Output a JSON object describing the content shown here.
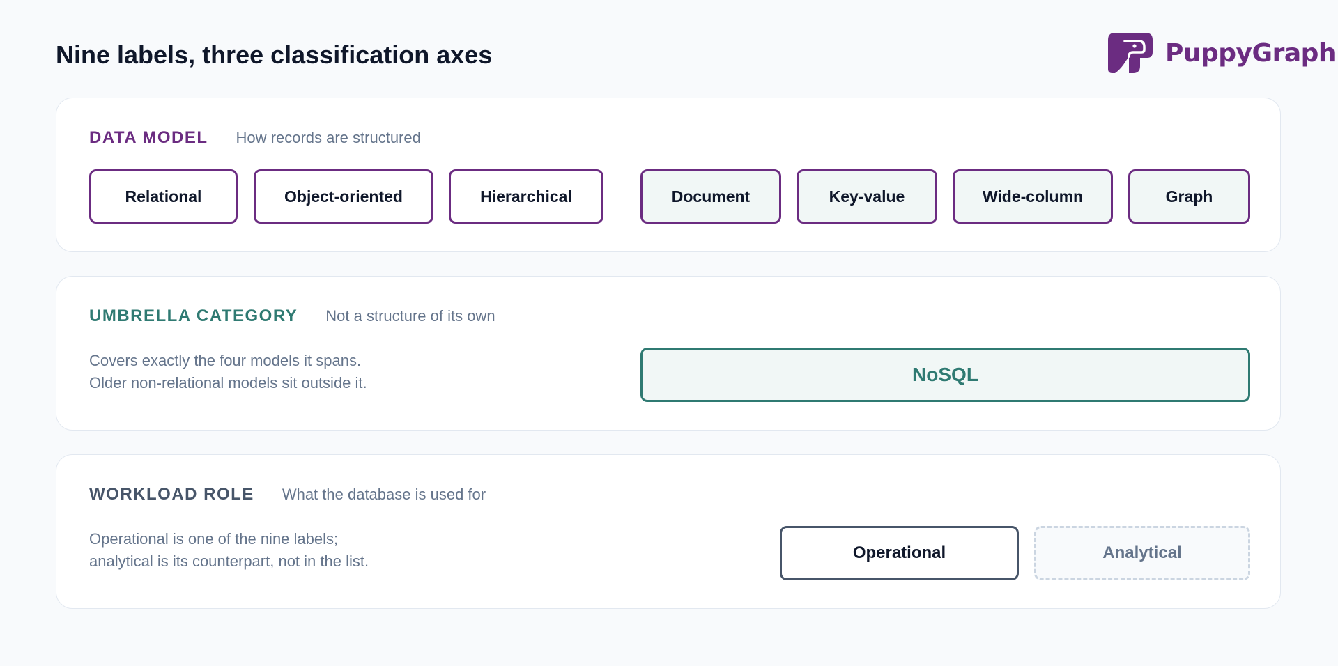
{
  "header": {
    "title": "Nine labels, three classification axes",
    "brand_name": "PuppyGraph"
  },
  "colors": {
    "brand": "#6b2c81",
    "umbrella": "#2f7a72",
    "workload": "#475569",
    "muted": "#64748b"
  },
  "data_model": {
    "axis_name": "DATA MODEL",
    "description": "How records are structured",
    "labels": [
      "Relational",
      "Object-oriented",
      "Hierarchical",
      "Document",
      "Key-value",
      "Wide-column",
      "Graph"
    ]
  },
  "umbrella": {
    "axis_name": "UMBRELLA CATEGORY",
    "description": "Not a structure of its own",
    "note_lines": [
      "Covers exactly the four models it spans.",
      "Older non-relational models sit outside it."
    ],
    "label": "NoSQL"
  },
  "workload": {
    "axis_name": "WORKLOAD ROLE",
    "description": "What the database is used for",
    "note_lines": [
      "Operational is one of the nine labels;",
      "analytical is its counterpart, not in the list."
    ],
    "operational_label": "Operational",
    "analytical_label": "Analytical"
  }
}
